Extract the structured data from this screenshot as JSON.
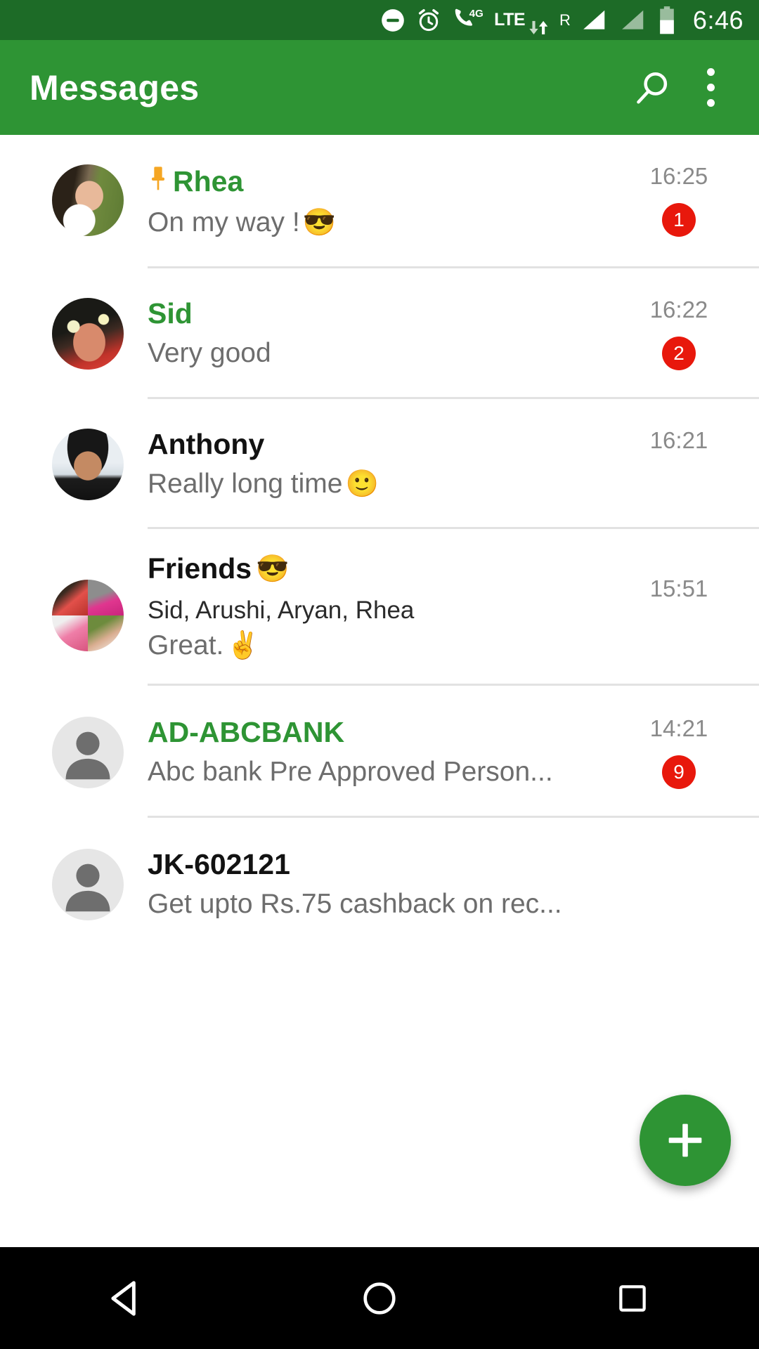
{
  "status_bar": {
    "time": "6:46",
    "icons": [
      "do-not-disturb-icon",
      "alarm-icon",
      "phone-4g-icon",
      "lte-data-icon",
      "roaming-icon",
      "signal-sim1-icon",
      "signal-sim2-icon",
      "battery-icon"
    ],
    "network_label": "LTE",
    "roaming_label": "R",
    "data_label_4g": "4G",
    "battery_level_percent": 55
  },
  "app_bar": {
    "title": "Messages",
    "search_label": "search-icon",
    "overflow_label": "more-options-icon",
    "background_color": "#2e9434"
  },
  "colors": {
    "accent_green": "#2e9434",
    "status_bar_green": "#1d6b27",
    "unread_badge_red": "#e8180c",
    "pin_orange": "#f5a623",
    "divider_gray": "#e2e2e2"
  },
  "conversations": [
    {
      "name": "Rhea",
      "pinned": true,
      "pin_icon": "pin-icon",
      "snippet": "On my way !",
      "snippet_emoji": "😎",
      "time": "16:25",
      "unread_count": "1",
      "unread": true,
      "avatar_type": "photo"
    },
    {
      "name": "Sid",
      "pinned": false,
      "snippet": "Very good",
      "snippet_emoji": "",
      "time": "16:22",
      "unread_count": "2",
      "unread": true,
      "avatar_type": "photo"
    },
    {
      "name": "Anthony",
      "pinned": false,
      "snippet": "Really long time",
      "snippet_emoji": "🙂",
      "time": "16:21",
      "unread_count": "",
      "unread": false,
      "avatar_type": "photo"
    },
    {
      "name": "Friends",
      "name_emoji": "😎",
      "pinned": false,
      "members": "Sid, Arushi, Aryan, Rhea",
      "snippet": "Great.",
      "snippet_emoji": "✌",
      "time": "15:51",
      "unread_count": "",
      "unread": false,
      "avatar_type": "group"
    },
    {
      "name": "AD-ABCBANK",
      "pinned": false,
      "snippet": "Abc bank Pre Approved Person...",
      "snippet_emoji": "",
      "time": "14:21",
      "unread_count": "9",
      "unread": true,
      "avatar_type": "default-person"
    },
    {
      "name": "JK-602121",
      "pinned": false,
      "snippet": "Get upto Rs.75 cashback on rec...",
      "snippet_emoji": "",
      "time": "",
      "unread_count": "",
      "unread": false,
      "avatar_type": "default-person"
    }
  ],
  "fab": {
    "label": "compose-new-message",
    "icon": "plus-icon"
  },
  "nav_bar": {
    "back": "back-icon",
    "home": "home-icon",
    "recents": "recents-icon"
  }
}
